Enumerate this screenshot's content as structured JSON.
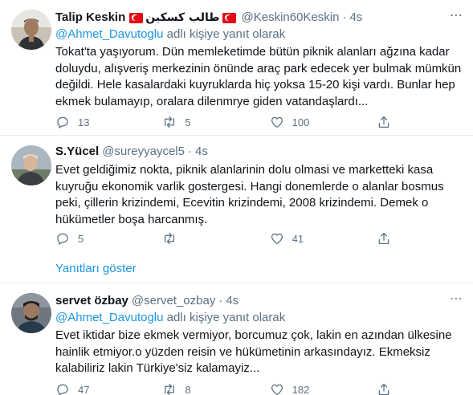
{
  "tweets": [
    {
      "name": "Talip Keskin",
      "name_arabic": "طالب كسكين",
      "handle": "@Keskin60Keskin",
      "time": "4s",
      "reply_prefix": "@Ahmet_Davutoglu",
      "reply_suffix": "adlı kişiye yanıt olarak",
      "text": "Tokat'ta yaşıyorum. Dün memleketimde bütün piknik alanları ağzına kadar doluydu, alışveriş merkezinin önünde araç park edecek yer bulmak mümkün değildi. Hele kasalardaki kuyruklarda hiç yoksa 15-20 kişi vardı. Bunlar hep ekmek bulamayıp, oralara dilenmrye giden vatandaşlardı...",
      "replies": "13",
      "retweets": "5",
      "likes": "100"
    },
    {
      "name": "S.Yücel",
      "handle": "@sureyyaycel5",
      "time": "4s",
      "text": "Evet geldiğimiz nokta, piknik alanlarinin dolu olmasi ve marketteki kasa kuyruğu ekonomik varlik gostergesi. Hangi donemlerde o alanlar bosmus peki, çillerin krizindemi, Ecevitin krizindemi, 2008 krizindemi. Demek o hükümetler boşa harcanmış.",
      "replies": "5",
      "retweets": "",
      "likes": "41"
    },
    {
      "name": "servet özbay",
      "handle": "@servet_ozbay",
      "time": "4s",
      "reply_prefix": "@Ahmet_Davutoglu",
      "reply_suffix": "adlı kişiye yanıt olarak",
      "text": "Evet iktidar bize ekmek vermiyor, borcumuz çok, lakin en azından ülkesine hainlik etmiyor.o yüzden reisin ve hükümetinin arkasındayız. Ekmeksiz kalabiliriz lakin Türkiye'siz kalamayiz...",
      "replies": "47",
      "retweets": "8",
      "likes": "182"
    }
  ],
  "show_replies_label": "Yanıtları göster",
  "dot": "·",
  "more_icon": "more-icon",
  "colors": {
    "link": "#1b95e0",
    "secondary": "#5b7083",
    "divider": "#e6ecf0"
  }
}
